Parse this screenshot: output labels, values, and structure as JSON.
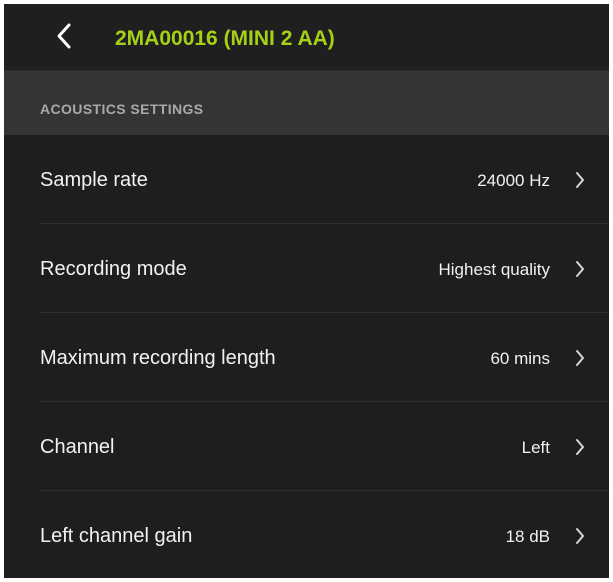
{
  "header": {
    "title": "2MA00016 (MINI 2 AA)",
    "title_color": "#a6d016",
    "back_icon": "chevron-left-icon"
  },
  "section": {
    "title": "ACOUSTICS SETTINGS"
  },
  "settings": [
    {
      "label": "Sample rate",
      "value": "24000 Hz"
    },
    {
      "label": "Recording mode",
      "value": "Highest quality"
    },
    {
      "label": "Maximum recording length",
      "value": "60 mins"
    },
    {
      "label": "Channel",
      "value": "Left"
    },
    {
      "label": "Left channel gain",
      "value": "18 dB"
    }
  ]
}
